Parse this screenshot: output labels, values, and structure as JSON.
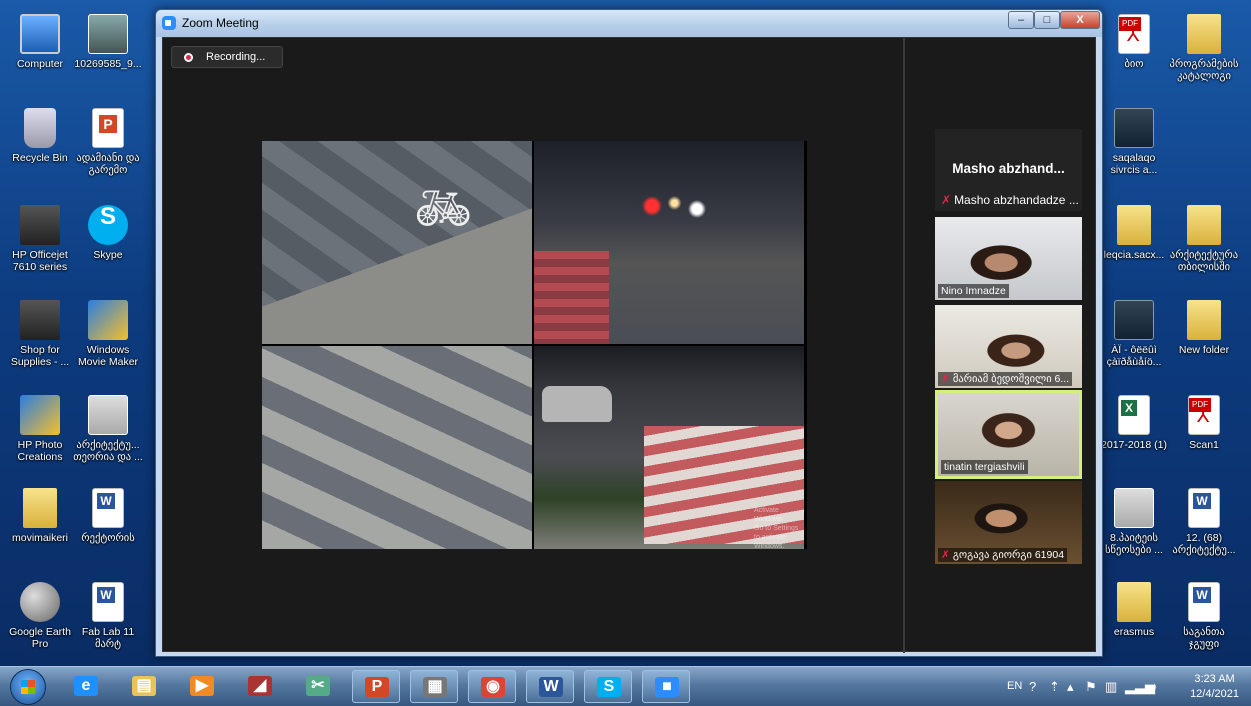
{
  "zoom": {
    "window_title": "Zoom Meeting",
    "recording_label": "Recording...",
    "minimize": "–",
    "maximize": "□",
    "close": "X",
    "screen_share_watermark": [
      "Activate Windows",
      "Go to Settings to activate Windows."
    ],
    "participants": [
      {
        "display": "Masho abzhand...",
        "name": "Masho abzhandadze ...",
        "muted": true,
        "video": false
      },
      {
        "name": "Nino Imnadze",
        "muted": false,
        "video": true
      },
      {
        "name": "მარიამ ბედოშვილი 6...",
        "muted": true,
        "video": true
      },
      {
        "name": "tinatin tergiashvili",
        "muted": false,
        "video": true,
        "active_speaker": true
      },
      {
        "name": "გოგავა გიორგი 61904",
        "muted": true,
        "video": true
      }
    ],
    "active_speaker_color": "#d2f07a",
    "recording_color": "#e0284b"
  },
  "desktop_left": [
    {
      "label": "Computer",
      "icon": "computer-icon",
      "cls": "comp"
    },
    {
      "label": "10269585_9...",
      "icon": "photo-icon",
      "cls": "photo"
    },
    {
      "label": "Recycle Bin",
      "icon": "recycle-bin-icon",
      "cls": "bin"
    },
    {
      "label": "ადამიანი და გარემო",
      "icon": "powerpoint-file-icon",
      "cls": "ppt"
    },
    {
      "label": "HP Officejet 7610 series",
      "icon": "printer-icon",
      "cls": "printer"
    },
    {
      "label": "Skype",
      "icon": "skype-icon",
      "cls": "skype"
    },
    {
      "label": "Shop for Supplies - ...",
      "icon": "printer-shop-icon",
      "cls": "printer"
    },
    {
      "label": "Windows Movie Maker",
      "icon": "movie-maker-icon",
      "cls": "movie"
    },
    {
      "label": "HP Photo Creations",
      "icon": "photo-creations-icon",
      "cls": "movie"
    },
    {
      "label": "არქიტექტუ... თეორია და ...",
      "icon": "powerpoint-file-icon",
      "cls": "thumb"
    },
    {
      "label": "movimaikeri",
      "icon": "folder-icon",
      "cls": "folder"
    },
    {
      "label": "რექტორის",
      "icon": "word-file-icon",
      "cls": "word"
    },
    {
      "label": "Google Earth Pro",
      "icon": "google-earth-icon",
      "cls": "globe"
    },
    {
      "label": "Fab Lab 11 მარტ",
      "icon": "word-file-icon",
      "cls": "word"
    }
  ],
  "desktop_right": [
    {
      "label": "ბიო",
      "icon": "pdf-file-icon",
      "cls": "pdf"
    },
    {
      "label": "პროგრამების კატალოგი",
      "icon": "folder-icon",
      "cls": "folder"
    },
    {
      "label": "saqalaqo sivrcis a...",
      "icon": "powerpoint-file-icon",
      "cls": "dark"
    },
    {
      "label": "leqcia.sacx...",
      "icon": "folder-icon",
      "cls": "folder"
    },
    {
      "label": "არქიტექტურა თბილისში",
      "icon": "folder-icon",
      "cls": "folder"
    },
    {
      "label": "ÀÏ - ôëëûì çàïðåùåíö...",
      "icon": "video-file-icon",
      "cls": "dark"
    },
    {
      "label": "New folder",
      "icon": "folder-icon",
      "cls": "folder"
    },
    {
      "label": "2017-2018 (1)",
      "icon": "excel-file-icon",
      "cls": "excel"
    },
    {
      "label": "Scan1",
      "icon": "pdf-file-icon",
      "cls": "pdf"
    },
    {
      "label": "8.პაიტეის სწეოსები ...",
      "icon": "powerpoint-file-icon",
      "cls": "thumb"
    },
    {
      "label": "12. (68) არქიტექტუ...",
      "icon": "word-file-icon",
      "cls": "word"
    },
    {
      "label": "erasmus",
      "icon": "folder-icon",
      "cls": "folder"
    },
    {
      "label": "საგანთა ჯგუფი",
      "icon": "word-file-icon",
      "cls": "word"
    }
  ],
  "taskbar": {
    "apps": [
      {
        "name": "ie-icon",
        "glyph": "e",
        "color": "#1e90ff"
      },
      {
        "name": "explorer-icon",
        "glyph": "▤",
        "color": "#e8c35a"
      },
      {
        "name": "media-player-icon",
        "glyph": "▶",
        "color": "#f08a24"
      },
      {
        "name": "archicad-icon",
        "glyph": "◢",
        "color": "#a33"
      },
      {
        "name": "snipping-tool-icon",
        "glyph": "✂",
        "color": "#5a8"
      },
      {
        "name": "powerpoint-icon",
        "glyph": "P",
        "color": "#d24726"
      },
      {
        "name": "scanner-icon",
        "glyph": "▦",
        "color": "#777"
      },
      {
        "name": "chrome-icon",
        "glyph": "◉",
        "color": "#db4437"
      },
      {
        "name": "word-icon",
        "glyph": "W",
        "color": "#2b579a"
      },
      {
        "name": "skype-icon",
        "glyph": "S",
        "color": "#00aff0"
      },
      {
        "name": "zoom-icon",
        "glyph": "■",
        "color": "#2d8cff"
      }
    ],
    "tray": {
      "language": "EN",
      "time": "3:23 AM",
      "date": "12/4/2021"
    }
  }
}
